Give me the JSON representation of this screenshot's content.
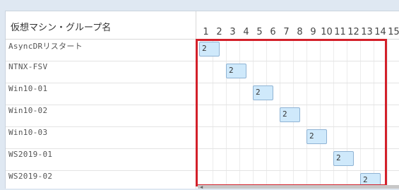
{
  "header": {
    "name_column": "仮想マシン・グループ名"
  },
  "days": [
    "1",
    "2",
    "3",
    "4",
    "5",
    "6",
    "7",
    "8",
    "9",
    "10",
    "11",
    "12",
    "13",
    "14",
    "15"
  ],
  "rows": [
    {
      "name": "AsyncDRリスタート",
      "count": "2"
    },
    {
      "name": "NTNX-FSV",
      "count": "2"
    },
    {
      "name": "Win10-01",
      "count": "2"
    },
    {
      "name": "Win10-02",
      "count": "2"
    },
    {
      "name": "Win10-03",
      "count": "2"
    },
    {
      "name": "WS2019-01",
      "count": "2"
    },
    {
      "name": "WS2019-02",
      "count": "2"
    }
  ],
  "colors": {
    "bar_fill": "#cfe9fb",
    "bar_border": "#8fb3d4",
    "selection_border": "#d3202a",
    "background": "#dfe8f2"
  }
}
